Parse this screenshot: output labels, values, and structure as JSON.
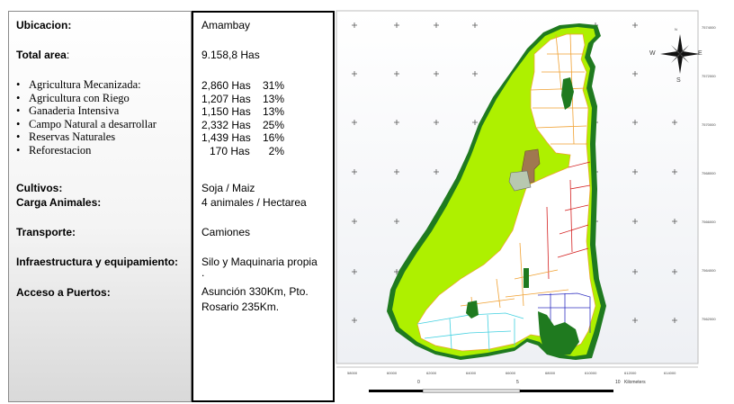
{
  "table": {
    "ubicacion": {
      "label": "Ubicacion:",
      "value": "Amambay"
    },
    "total_area": {
      "label": "Total area",
      "suffix": ":",
      "value": "9.158,8 Has"
    },
    "land_use": [
      {
        "label": "Agricultura Mecanizada:",
        "has": "2,860 Has",
        "pct": "31%"
      },
      {
        "label": "Agricultura con Riego",
        "has": "1,207 Has",
        "pct": "13%"
      },
      {
        "label": "Ganaderia Intensiva",
        "has": "1,150 Has",
        "pct": "13%"
      },
      {
        "label": "Campo Natural a desarrollar",
        "has": "2,332 Has",
        "pct": "25%"
      },
      {
        "label": "Reservas Naturales",
        "has": "1,439 Has",
        "pct": "16%"
      },
      {
        "label": "Reforestacion",
        "has": "170 Has",
        "pct": "2%"
      }
    ],
    "cultivos": {
      "label": "Cultivos:",
      "value": "Soja / Maiz"
    },
    "carga": {
      "label": "Carga Animales:",
      "value": "4 animales / Hectarea"
    },
    "transporte": {
      "label": "Transporte:",
      "value": "Camiones"
    },
    "infraestructura": {
      "label": "Infraestructura y equipamiento:",
      "value_line1": "Silo y Maquinaria  propia",
      "value_line2": "."
    },
    "acceso": {
      "label": "Acceso a Puertos:",
      "value_line1": "Asunción 330Km, Pto.",
      "value_line2": "Rosario 235Km."
    }
  },
  "map": {
    "compass": {
      "n": "N",
      "s": "S",
      "e": "E",
      "w": "W"
    },
    "scale": {
      "zero": "0",
      "five": "5",
      "ten": "10",
      "unit": "Kilometers"
    },
    "x_ticks": [
      "58000",
      "60000",
      "62000",
      "64000",
      "66000",
      "68000",
      "610000",
      "612000",
      "614000"
    ],
    "y_ticks": [
      "7574000",
      "7572000",
      "7570000",
      "7568000",
      "7566000",
      "7564000",
      "7562000"
    ],
    "colors": {
      "reserve": "#1f7a1f",
      "natural": "#aef000",
      "parcel_orange": "#f0a030",
      "parcel_red": "#d42020",
      "parcel_cyan": "#40d0e0",
      "parcel_blue": "#3030c0",
      "parcel_brown": "#a07850"
    }
  }
}
